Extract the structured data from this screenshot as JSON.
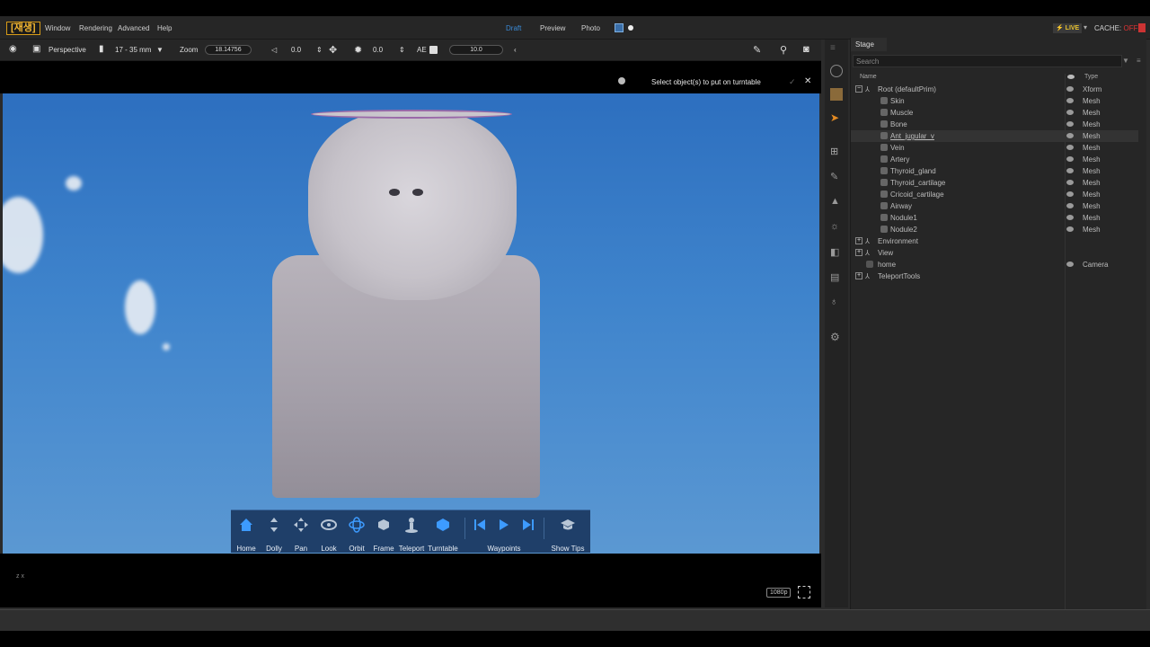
{
  "menubar": {
    "badge": "[재생]",
    "items": [
      "Window",
      "Rendering",
      "Advanced",
      "Help"
    ],
    "render_tabs": [
      "Draft",
      "Preview",
      "Photo"
    ],
    "live_label": "LIVE",
    "cache_label": "CACHE:",
    "cache_value": "OFF"
  },
  "toolbar": {
    "camera": "Perspective",
    "lens": "17 - 35 mm",
    "zoom_label": "Zoom",
    "zoom_value": "18.14756",
    "angle1": "0.0",
    "angle2": "0.0",
    "ae_label": "AE",
    "exposure": "10.0"
  },
  "viewport": {
    "message": "Select object(s) to put on turntable",
    "resolution": "1080p",
    "axis_label": "z x"
  },
  "navbar": {
    "items": [
      "Home",
      "Dolly",
      "Pan",
      "Look",
      "Orbit",
      "Frame",
      "Teleport",
      "Turntable",
      "Waypoints",
      "Show Tips"
    ]
  },
  "stage": {
    "tab": "Stage",
    "search_placeholder": "Search",
    "col_name": "Name",
    "col_type": "Type",
    "rows": [
      {
        "name": "Root (defaultPrim)",
        "type": "Xform"
      },
      {
        "name": "Skin",
        "type": "Mesh"
      },
      {
        "name": "Muscle",
        "type": "Mesh"
      },
      {
        "name": "Bone",
        "type": "Mesh"
      },
      {
        "name": "Ant_jugular_v",
        "type": "Mesh"
      },
      {
        "name": "Vein",
        "type": "Mesh"
      },
      {
        "name": "Artery",
        "type": "Mesh"
      },
      {
        "name": "Thyroid_gland",
        "type": "Mesh"
      },
      {
        "name": "Thyroid_cartilage",
        "type": "Mesh"
      },
      {
        "name": "Cricoid_cartilage",
        "type": "Mesh"
      },
      {
        "name": "Airway",
        "type": "Mesh"
      },
      {
        "name": "Nodule1",
        "type": "Mesh"
      },
      {
        "name": "Nodule2",
        "type": "Mesh"
      },
      {
        "name": "Environment",
        "type": ""
      },
      {
        "name": "View",
        "type": ""
      },
      {
        "name": "home",
        "type": "Camera"
      },
      {
        "name": "TeleportTools",
        "type": ""
      }
    ]
  },
  "colors": {
    "accent": "#3a8ad6",
    "navbar": "#1f3f69",
    "sky": "#3f84cc"
  }
}
